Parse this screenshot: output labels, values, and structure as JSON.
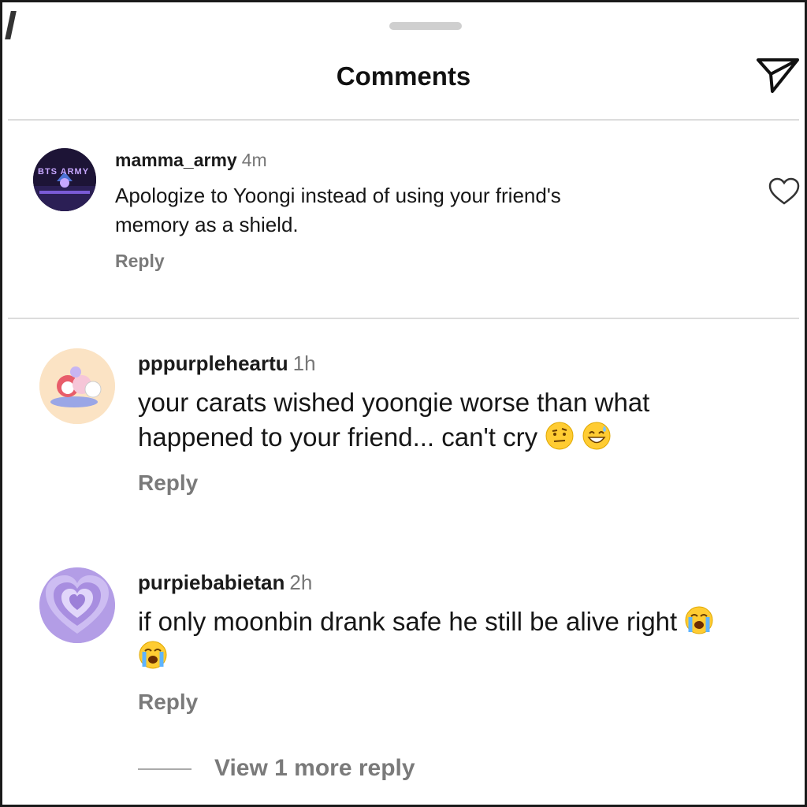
{
  "header": {
    "title": "Comments",
    "share_icon": "send-icon"
  },
  "comments": [
    {
      "username": "mamma_army",
      "time": "4m",
      "text_line1": "Apologize to Yoongi instead of using your friend's",
      "text_line2": "memory as a shield.",
      "reply_label": "Reply",
      "avatar": "concert-stage-avatar",
      "avatar_text": "BTS ARMY",
      "like_icon": "heart-outline-icon"
    },
    {
      "username": "pppurpleheartu",
      "time": "1h",
      "text_line1": "your carats wished yoongie worse than what",
      "text_line2": "happened to your friend... can't cry",
      "emojis": [
        "raised-eyebrow-emoji",
        "grinning-sweat-emoji"
      ],
      "reply_label": "Reply",
      "avatar": "bt21-characters-avatar"
    },
    {
      "username": "purpiebabietan",
      "time": "2h",
      "text_line1": "if only moonbin drank safe he still be alive right",
      "emojis": [
        "crying-emoji",
        "crying-emoji"
      ],
      "reply_label": "Reply",
      "avatar": "purple-heart-avatar"
    }
  ],
  "view_more_label": "View 1 more reply",
  "colors": {
    "text": "#161616",
    "muted": "#7a7a7a",
    "divider": "#dcdcdc",
    "purple": "#b49be0"
  }
}
